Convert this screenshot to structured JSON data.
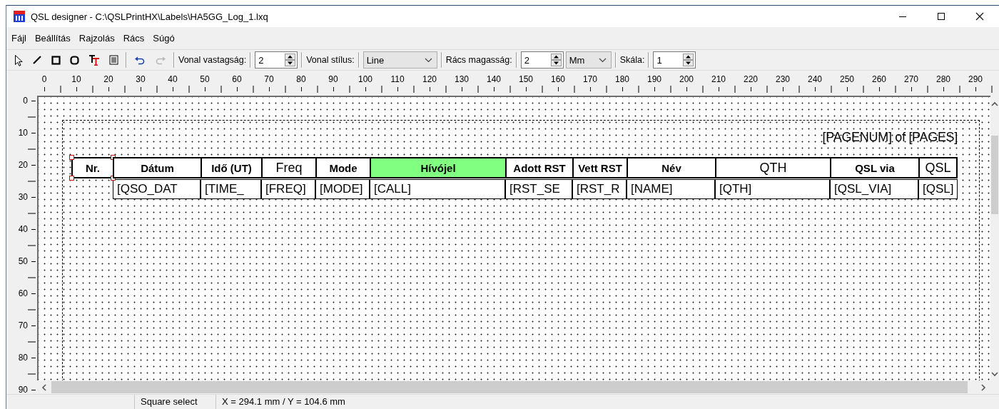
{
  "window": {
    "title": "QSL designer - C:\\QSLPrintHX\\Labels\\HA5GG_Log_1.lxq"
  },
  "menu": [
    "Fájl",
    "Beállítás",
    "Rajzolás",
    "Rács",
    "Súgó"
  ],
  "toolbar": [
    {
      "kind": "pointer"
    },
    {
      "kind": "line"
    },
    {
      "kind": "rectangle"
    },
    {
      "kind": "rounded-rectangle"
    },
    {
      "kind": "text-tool"
    },
    {
      "kind": "list"
    },
    {
      "kind": "separator"
    },
    {
      "kind": "undo",
      "disabled": false
    },
    {
      "kind": "redo",
      "disabled": true
    },
    {
      "kind": "separator"
    },
    {
      "kind": "label",
      "text": "Vonal vastagság:"
    },
    {
      "kind": "separator"
    },
    {
      "kind": "spin",
      "value": "2"
    },
    {
      "kind": "separator"
    },
    {
      "kind": "label",
      "text": "Vonal stílus:"
    },
    {
      "kind": "separator"
    },
    {
      "kind": "combo",
      "value": "Line"
    },
    {
      "kind": "separator"
    },
    {
      "kind": "label",
      "text": "Rács magasság:"
    },
    {
      "kind": "separator"
    },
    {
      "kind": "spin",
      "value": "2"
    },
    {
      "kind": "combo",
      "value": "Mm"
    },
    {
      "kind": "separator"
    },
    {
      "kind": "label",
      "text": "Skála:"
    },
    {
      "kind": "separator"
    },
    {
      "kind": "spin",
      "value": "1"
    }
  ],
  "h_ruler": {
    "labels": [
      "0",
      "10",
      "20",
      "30",
      "40",
      "50",
      "60",
      "70",
      "80",
      "90",
      "100",
      "110",
      "120",
      "130",
      "140",
      "150",
      "160",
      "170",
      "180",
      "190",
      "200",
      "210",
      "220",
      "230",
      "240",
      "250",
      "260",
      "270",
      "280",
      "290"
    ]
  },
  "v_ruler": {
    "labels": [
      "0",
      "10",
      "20",
      "30",
      "40",
      "50",
      "60",
      "70",
      "80",
      "90"
    ]
  },
  "page_footer": "[PAGENUM] of [PAGES]",
  "table": {
    "columns": [
      {
        "header": "Nr.",
        "bold": true,
        "selected": true
      },
      {
        "header": "Dátum",
        "bold": true,
        "selected": false,
        "field": "[QSO_DAT"
      },
      {
        "header": "Idő (UT)",
        "bold": true,
        "selected": false,
        "field": "[TIME_"
      },
      {
        "header": "Freq",
        "bold": false,
        "selected": false,
        "field": "[FREQ]"
      },
      {
        "header": "Mode",
        "bold": true,
        "selected": false,
        "field": "[MODE]"
      },
      {
        "header": "Hívójel",
        "bold": true,
        "selected": false,
        "color": "#80ff80",
        "field": "[CALL]"
      },
      {
        "header": "Adott RST",
        "bold": true,
        "selected": false,
        "field": "[RST_SE"
      },
      {
        "header": "Vett RST",
        "bold": true,
        "selected": false,
        "field": "[RST_R"
      },
      {
        "header": "Név",
        "bold": true,
        "selected": false,
        "field": "[NAME]"
      },
      {
        "header": "QTH",
        "bold": false,
        "selected": false,
        "field": "[QTH]"
      },
      {
        "header": "QSL via",
        "bold": true,
        "selected": false,
        "field": "[QSL_VIA]"
      },
      {
        "header": "QSL",
        "bold": false,
        "selected": false,
        "field": "[QSL]"
      }
    ]
  },
  "status_bar": [
    "Square select",
    "X = 294.1 mm / Y = 104.6 mm"
  ]
}
